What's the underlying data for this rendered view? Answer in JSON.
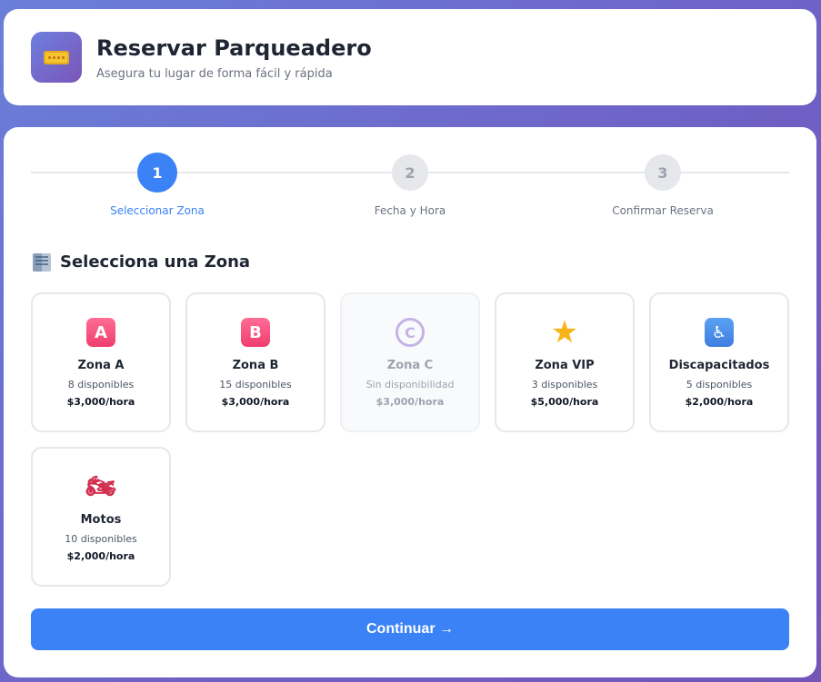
{
  "header": {
    "title": "Reservar Parqueadero",
    "subtitle": "Asegura tu lugar de forma fácil y rápida",
    "logo_icon": "ticket-icon"
  },
  "stepper": {
    "steps": [
      {
        "number": "1",
        "label": "Seleccionar Zona",
        "state": "active"
      },
      {
        "number": "2",
        "label": "Fecha y Hora",
        "state": "inactive"
      },
      {
        "number": "3",
        "label": "Confirmar Reserva",
        "state": "inactive"
      }
    ]
  },
  "section": {
    "title": "Selecciona una Zona",
    "icon": "building-icon"
  },
  "zones": [
    {
      "icon_text": "A",
      "icon": "letter-a-icon",
      "name": "Zona A",
      "availability": "8 disponibles",
      "price": "$3,000/hora",
      "enabled": true
    },
    {
      "icon_text": "B",
      "icon": "letter-b-icon",
      "name": "Zona B",
      "availability": "15 disponibles",
      "price": "$3,000/hora",
      "enabled": true
    },
    {
      "icon_text": "C",
      "icon": "letter-c-icon",
      "name": "Zona C",
      "availability": "Sin disponibilidad",
      "price": "$3,000/hora",
      "enabled": false
    },
    {
      "icon_text": "★",
      "icon": "star-icon",
      "name": "Zona VIP",
      "availability": "3 disponibles",
      "price": "$5,000/hora",
      "enabled": true
    },
    {
      "icon_text": "♿",
      "icon": "wheelchair-icon",
      "name": "Discapacitados",
      "availability": "5 disponibles",
      "price": "$2,000/hora",
      "enabled": true
    },
    {
      "icon_text": "🏍",
      "icon": "motorcycle-icon",
      "name": "Motos",
      "availability": "10 disponibles",
      "price": "$2,000/hora",
      "enabled": true
    }
  ],
  "actions": {
    "continue_label": "Continuar →"
  },
  "colors": {
    "primary": "#3b82f6",
    "background_gradient_start": "#6a7fd9",
    "background_gradient_end": "#7356b8"
  }
}
